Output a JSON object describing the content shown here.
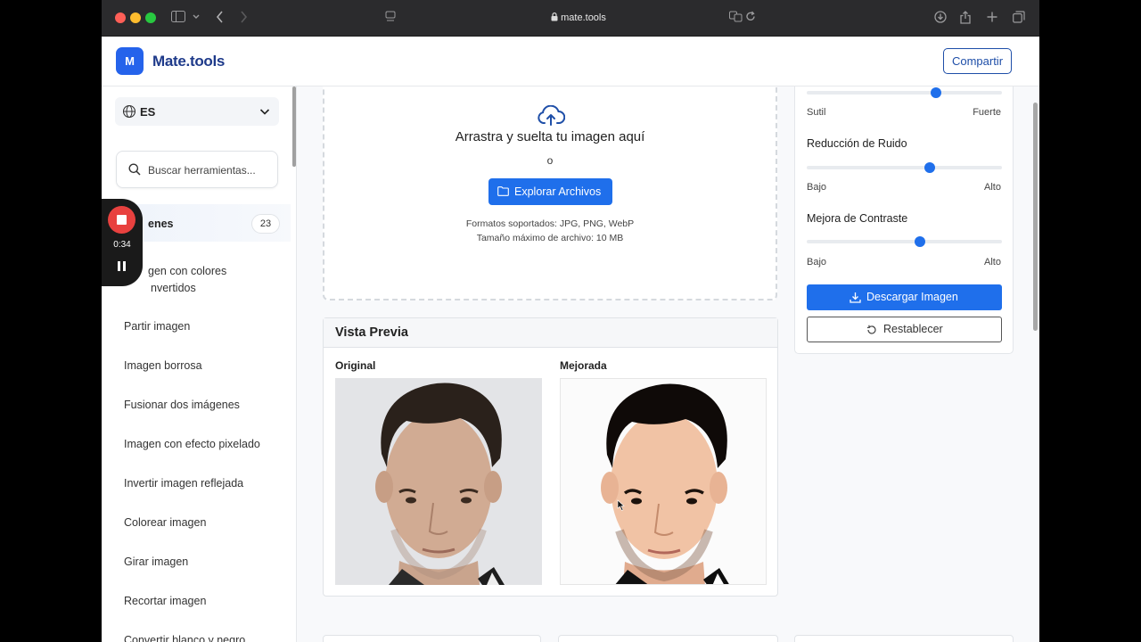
{
  "browser": {
    "url": "mate.tools",
    "traffic_colors": [
      "#fe5f57",
      "#febc2e",
      "#28c840"
    ]
  },
  "header": {
    "logo_letter": "M",
    "site_name": "Mate.tools",
    "share_label": "Compartir"
  },
  "sidebar": {
    "language": "ES",
    "search_placeholder": "Buscar herramientas...",
    "category": {
      "label": "Imágenes",
      "visible_label": "enes",
      "count": "23"
    },
    "items": [
      "Imagen con colores invertidos",
      "Partir imagen",
      "Imagen borrosa",
      "Fusionar dos imágenes",
      "Imagen con efecto pixelado",
      "Invertir imagen reflejada",
      "Colorear imagen",
      "Girar imagen",
      "Recortar imagen",
      "Convertir blanco y negro"
    ],
    "items_visible": {
      "first_line1": "gen con colores",
      "first_line2": "nvertidos"
    }
  },
  "recording": {
    "time": "0:34",
    "color": "#e8413f"
  },
  "upload": {
    "title": "Arrastra y suelta tu imagen aquí",
    "or": "o",
    "browse_label": "Explorar Archivos",
    "formats": "Formatos soportados: JPG, PNG, WebP",
    "max_size": "Tamaño máximo de archivo: 10 MB"
  },
  "preview": {
    "title": "Vista Previa",
    "original_label": "Original",
    "enhanced_label": "Mejorada"
  },
  "controls": {
    "sliders": [
      {
        "title": "",
        "min_label": "Sutil",
        "max_label": "Fuerte",
        "value": 0.66
      },
      {
        "title": "Reducción de Ruido",
        "min_label": "Bajo",
        "max_label": "Alto",
        "value": 0.63
      },
      {
        "title": "Mejora de Contraste",
        "min_label": "Bajo",
        "max_label": "Alto",
        "value": 0.58
      }
    ],
    "download_label": "Descargar Imagen",
    "reset_label": "Restablecer"
  },
  "colors": {
    "accent": "#1f6feb",
    "brand_text": "#1e3a8a"
  }
}
